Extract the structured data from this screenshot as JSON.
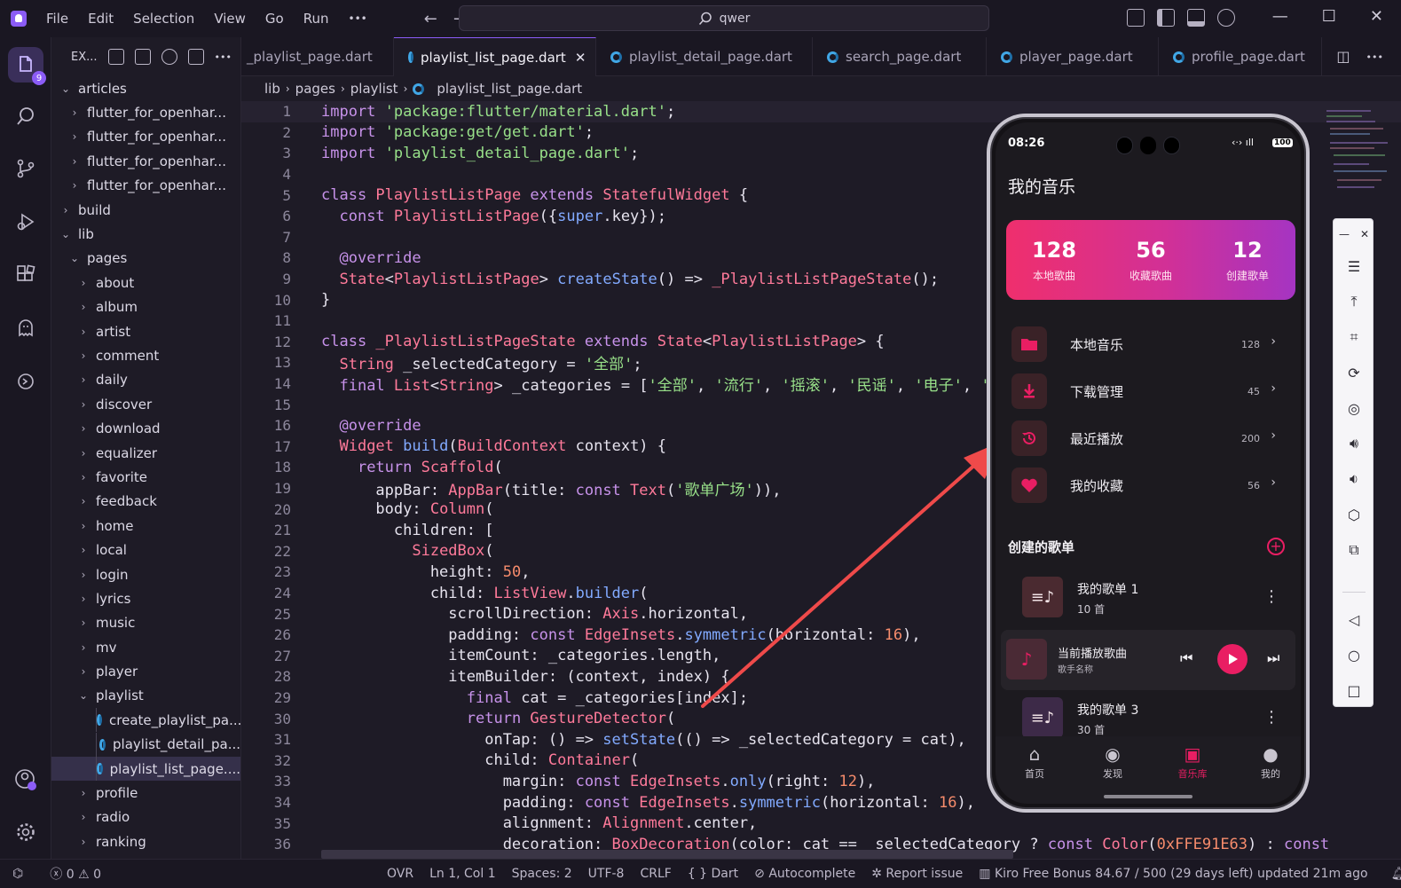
{
  "menu": [
    "File",
    "Edit",
    "Selection",
    "View",
    "Go",
    "Run",
    "•••"
  ],
  "search": {
    "value": "qwer"
  },
  "explorer": {
    "title": "EX...",
    "more": "•••",
    "badge": "9",
    "tree": [
      {
        "label": "articles",
        "depth": 1,
        "type": "folder-open"
      },
      {
        "label": "flutter_for_openhar...",
        "depth": 2,
        "type": "folder"
      },
      {
        "label": "flutter_for_openhar...",
        "depth": 2,
        "type": "folder"
      },
      {
        "label": "flutter_for_openhar...",
        "depth": 2,
        "type": "folder"
      },
      {
        "label": "flutter_for_openhar...",
        "depth": 2,
        "type": "folder"
      },
      {
        "label": "build",
        "depth": 1,
        "type": "folder"
      },
      {
        "label": "lib",
        "depth": 1,
        "type": "folder-open"
      },
      {
        "label": "pages",
        "depth": 2,
        "type": "folder-open"
      },
      {
        "label": "about",
        "depth": 3,
        "type": "folder"
      },
      {
        "label": "album",
        "depth": 3,
        "type": "folder"
      },
      {
        "label": "artist",
        "depth": 3,
        "type": "folder"
      },
      {
        "label": "comment",
        "depth": 3,
        "type": "folder"
      },
      {
        "label": "daily",
        "depth": 3,
        "type": "folder"
      },
      {
        "label": "discover",
        "depth": 3,
        "type": "folder"
      },
      {
        "label": "download",
        "depth": 3,
        "type": "folder"
      },
      {
        "label": "equalizer",
        "depth": 3,
        "type": "folder"
      },
      {
        "label": "favorite",
        "depth": 3,
        "type": "folder"
      },
      {
        "label": "feedback",
        "depth": 3,
        "type": "folder"
      },
      {
        "label": "home",
        "depth": 3,
        "type": "folder"
      },
      {
        "label": "local",
        "depth": 3,
        "type": "folder"
      },
      {
        "label": "login",
        "depth": 3,
        "type": "folder"
      },
      {
        "label": "lyrics",
        "depth": 3,
        "type": "folder"
      },
      {
        "label": "music",
        "depth": 3,
        "type": "folder"
      },
      {
        "label": "mv",
        "depth": 3,
        "type": "folder"
      },
      {
        "label": "player",
        "depth": 3,
        "type": "folder"
      },
      {
        "label": "playlist",
        "depth": 3,
        "type": "folder-open"
      },
      {
        "label": "create_playlist_pa...",
        "depth": 4,
        "type": "dart"
      },
      {
        "label": "playlist_detail_pa...",
        "depth": 4,
        "type": "dart"
      },
      {
        "label": "playlist_list_page....",
        "depth": 4,
        "type": "dart",
        "selected": true
      },
      {
        "label": "profile",
        "depth": 3,
        "type": "folder"
      },
      {
        "label": "radio",
        "depth": 3,
        "type": "folder"
      },
      {
        "label": "ranking",
        "depth": 3,
        "type": "folder"
      }
    ]
  },
  "tabs": [
    {
      "label": "_playlist_page.dart",
      "active": false
    },
    {
      "label": "playlist_list_page.dart",
      "active": true
    },
    {
      "label": "playlist_detail_page.dart",
      "active": false
    },
    {
      "label": "search_page.dart",
      "active": false
    },
    {
      "label": "player_page.dart",
      "active": false
    },
    {
      "label": "profile_page.dart",
      "active": false
    }
  ],
  "breadcrumb": [
    "lib",
    "pages",
    "playlist",
    "playlist_list_page.dart"
  ],
  "code": [
    [
      [
        "kw",
        "import "
      ],
      [
        "str",
        "'package:flutter/material.dart'"
      ],
      [
        "p",
        ";"
      ]
    ],
    [
      [
        "kw",
        "import "
      ],
      [
        "str",
        "'package:get/get.dart'"
      ],
      [
        "p",
        ";"
      ]
    ],
    [
      [
        "kw",
        "import "
      ],
      [
        "str",
        "'playlist_detail_page.dart'"
      ],
      [
        "p",
        ";"
      ]
    ],
    [],
    [
      [
        "kw",
        "class "
      ],
      [
        "cls",
        "PlaylistListPage"
      ],
      [
        "kw",
        " extends "
      ],
      [
        "cls",
        "StatefulWidget"
      ],
      [
        "p",
        " {"
      ]
    ],
    [
      [
        "p",
        "  "
      ],
      [
        "kw",
        "const "
      ],
      [
        "cls",
        "PlaylistListPage"
      ],
      [
        "p",
        "({"
      ],
      [
        "kw2",
        "super"
      ],
      [
        "p",
        ".key});"
      ]
    ],
    [],
    [
      [
        "p",
        "  "
      ],
      [
        "ann",
        "@override"
      ]
    ],
    [
      [
        "p",
        "  "
      ],
      [
        "cls",
        "State"
      ],
      [
        "p",
        "<"
      ],
      [
        "cls",
        "PlaylistListPage"
      ],
      [
        "p",
        "> "
      ],
      [
        "fn",
        "createState"
      ],
      [
        "p",
        "() => "
      ],
      [
        "cls",
        "_PlaylistListPageState"
      ],
      [
        "p",
        "();"
      ]
    ],
    [
      [
        "p",
        "}"
      ]
    ],
    [],
    [
      [
        "kw",
        "class "
      ],
      [
        "cls",
        "_PlaylistListPageState"
      ],
      [
        "kw",
        " extends "
      ],
      [
        "cls",
        "State"
      ],
      [
        "p",
        "<"
      ],
      [
        "cls",
        "PlaylistListPage"
      ],
      [
        "p",
        "> {"
      ]
    ],
    [
      [
        "p",
        "  "
      ],
      [
        "cls",
        "String"
      ],
      [
        "p",
        " _selectedCategory = "
      ],
      [
        "str",
        "'全部'"
      ],
      [
        "p",
        ";"
      ]
    ],
    [
      [
        "p",
        "  "
      ],
      [
        "kw",
        "final "
      ],
      [
        "cls",
        "List"
      ],
      [
        "p",
        "<"
      ],
      [
        "cls",
        "String"
      ],
      [
        "p",
        "> _categories = ["
      ],
      [
        "str",
        "'全部'"
      ],
      [
        "p",
        ", "
      ],
      [
        "str",
        "'流行'"
      ],
      [
        "p",
        ", "
      ],
      [
        "str",
        "'摇滚'"
      ],
      [
        "p",
        ", "
      ],
      [
        "str",
        "'民谣'"
      ],
      [
        "p",
        ", "
      ],
      [
        "str",
        "'电子'"
      ],
      [
        "p",
        ", "
      ],
      [
        "str",
        "'古典'"
      ]
    ],
    [],
    [
      [
        "p",
        "  "
      ],
      [
        "ann",
        "@override"
      ]
    ],
    [
      [
        "p",
        "  "
      ],
      [
        "cls",
        "Widget"
      ],
      [
        "p",
        " "
      ],
      [
        "fn",
        "build"
      ],
      [
        "p",
        "("
      ],
      [
        "cls",
        "BuildContext"
      ],
      [
        "p",
        " context) {"
      ]
    ],
    [
      [
        "p",
        "    "
      ],
      [
        "kw",
        "return "
      ],
      [
        "cls",
        "Scaffold"
      ],
      [
        "p",
        "("
      ]
    ],
    [
      [
        "p",
        "      appBar: "
      ],
      [
        "cls",
        "AppBar"
      ],
      [
        "p",
        "(title: "
      ],
      [
        "kw",
        "const "
      ],
      [
        "cls",
        "Text"
      ],
      [
        "p",
        "("
      ],
      [
        "str",
        "'歌单广场'"
      ],
      [
        "p",
        ")),"
      ]
    ],
    [
      [
        "p",
        "      body: "
      ],
      [
        "cls",
        "Column"
      ],
      [
        "p",
        "("
      ]
    ],
    [
      [
        "p",
        "        children: ["
      ]
    ],
    [
      [
        "p",
        "          "
      ],
      [
        "cls",
        "SizedBox"
      ],
      [
        "p",
        "("
      ]
    ],
    [
      [
        "p",
        "            height: "
      ],
      [
        "num",
        "50"
      ],
      [
        "p",
        ","
      ]
    ],
    [
      [
        "p",
        "            child: "
      ],
      [
        "cls",
        "ListView"
      ],
      [
        "p",
        "."
      ],
      [
        "fn",
        "builder"
      ],
      [
        "p",
        "("
      ]
    ],
    [
      [
        "p",
        "              scrollDirection: "
      ],
      [
        "cls",
        "Axis"
      ],
      [
        "p",
        ".horizontal,"
      ]
    ],
    [
      [
        "p",
        "              padding: "
      ],
      [
        "kw",
        "const "
      ],
      [
        "cls",
        "EdgeInsets"
      ],
      [
        "p",
        "."
      ],
      [
        "fn",
        "symmetric"
      ],
      [
        "p",
        "(horizontal: "
      ],
      [
        "num",
        "16"
      ],
      [
        "p",
        "),"
      ]
    ],
    [
      [
        "p",
        "              itemCount: _categories.length,"
      ]
    ],
    [
      [
        "p",
        "              itemBuilder: (context, index) {"
      ]
    ],
    [
      [
        "p",
        "                "
      ],
      [
        "kw",
        "final "
      ],
      [
        "p",
        "cat = _categories[index];"
      ]
    ],
    [
      [
        "p",
        "                "
      ],
      [
        "kw",
        "return "
      ],
      [
        "cls",
        "GestureDetector"
      ],
      [
        "p",
        "("
      ]
    ],
    [
      [
        "p",
        "                  onTap: () => "
      ],
      [
        "fn",
        "setState"
      ],
      [
        "p",
        "(() => _selectedCategory = cat),"
      ]
    ],
    [
      [
        "p",
        "                  child: "
      ],
      [
        "cls",
        "Container"
      ],
      [
        "p",
        "("
      ]
    ],
    [
      [
        "p",
        "                    margin: "
      ],
      [
        "kw",
        "const "
      ],
      [
        "cls",
        "EdgeInsets"
      ],
      [
        "p",
        "."
      ],
      [
        "fn",
        "only"
      ],
      [
        "p",
        "(right: "
      ],
      [
        "num",
        "12"
      ],
      [
        "p",
        "),"
      ]
    ],
    [
      [
        "p",
        "                    padding: "
      ],
      [
        "kw",
        "const "
      ],
      [
        "cls",
        "EdgeInsets"
      ],
      [
        "p",
        "."
      ],
      [
        "fn",
        "symmetric"
      ],
      [
        "p",
        "(horizontal: "
      ],
      [
        "num",
        "16"
      ],
      [
        "p",
        "),"
      ]
    ],
    [
      [
        "p",
        "                    alignment: "
      ],
      [
        "cls",
        "Alignment"
      ],
      [
        "p",
        ".center,"
      ]
    ],
    [
      [
        "p",
        "                    decoration: "
      ],
      [
        "cls",
        "BoxDecoration"
      ],
      [
        "p",
        "(color: cat == _selectedCategory ? "
      ],
      [
        "kw",
        "const "
      ],
      [
        "cls",
        "Color"
      ],
      [
        "p",
        "("
      ],
      [
        "num",
        "0xFFE91E63"
      ],
      [
        "p",
        ") : "
      ],
      [
        "kw",
        "const"
      ]
    ]
  ],
  "status": {
    "remote": "⌬",
    "errors": "0",
    "warnings": "0",
    "ovr": "OVR",
    "position": "Ln 1, Col 1",
    "spaces": "Spaces: 2",
    "encoding": "UTF-8",
    "eol": "CRLF",
    "language": "Dart",
    "autocomplete": "Autocomplete",
    "report": "Report issue",
    "bonus": "Kiro Free Bonus 84.67 / 500 (29 days left) updated 21m ago"
  },
  "phone": {
    "time": "08:26",
    "battery": "100",
    "title": "我的音乐",
    "stats": [
      {
        "num": "128",
        "label": "本地歌曲"
      },
      {
        "num": "56",
        "label": "收藏歌曲"
      },
      {
        "num": "12",
        "label": "创建歌单"
      }
    ],
    "menu": [
      {
        "label": "本地音乐",
        "count": "128",
        "icon": "folder-icon"
      },
      {
        "label": "下载管理",
        "count": "45",
        "icon": "download-icon"
      },
      {
        "label": "最近播放",
        "count": "200",
        "icon": "history-icon"
      },
      {
        "label": "我的收藏",
        "count": "56",
        "icon": "heart-icon"
      }
    ],
    "section_title": "创建的歌单",
    "playlists": [
      {
        "name": "我的歌单 1",
        "count": "10 首"
      },
      {
        "name": "我的歌单 3",
        "count": "30 首"
      }
    ],
    "now_playing": {
      "title": "当前播放歌曲",
      "artist": "歌手名称"
    },
    "nav": [
      "首页",
      "发现",
      "音乐库",
      "我的"
    ],
    "accent": "#e91e63"
  },
  "colors": {
    "keyword": "#c792ea",
    "string": "#98e089",
    "class": "#ff7a9a",
    "function": "#82aaff",
    "annotation": "#c792ea",
    "number": "#f78c6c"
  }
}
